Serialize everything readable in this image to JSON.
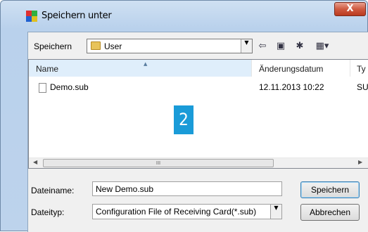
{
  "window": {
    "title": "Speichern unter",
    "close_label": "X"
  },
  "toolbar": {
    "location_label": "Speichern",
    "location_value": "User",
    "icons": [
      "back-arrow-icon",
      "up-folder-icon",
      "new-folder-icon",
      "view-menu-icon"
    ]
  },
  "list": {
    "columns": [
      "Name",
      "Änderungsdatum",
      "Ty"
    ],
    "rows": [
      {
        "name": "Demo.sub",
        "date": "12.11.2013 10:22",
        "type": "SU"
      }
    ],
    "scroll_grip": "III"
  },
  "marker": {
    "text": "2",
    "color": "#1a9bd8"
  },
  "form": {
    "filename_label": "Dateiname:",
    "filename_value": "New Demo.sub",
    "filetype_label": "Dateityp:",
    "filetype_value": "Configuration File of Receiving Card(*.sub)"
  },
  "buttons": {
    "save": "Speichern",
    "cancel": "Abbrechen"
  }
}
